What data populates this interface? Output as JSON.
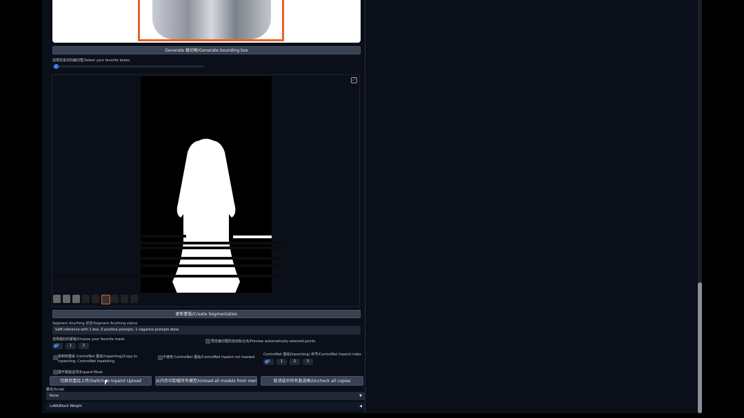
{
  "buttons": {
    "generate_bbox": "Generate 裁切框/Generate bounding box",
    "create_mask": "更新蒙版/Create Segmentation",
    "switch_inpaint": "切换到重绘上传/Switch to Inpaint Upload",
    "unload_models": "从内存中卸载所有模型/Unload all models from memory",
    "uncheck_all": "取消选中所有复选框/Uncheck all copies"
  },
  "labels": {
    "select_box": "选择您喜欢的裁切框/Select your favorite boxes",
    "sam_status": "Segment Anything 状态/Segment Anything status",
    "sam_status_value": "SaM inference with 1 box, 0 positive prompts, 1 negative prompts done",
    "choose_mask": "选择最好的蒙版/Choose your favorite mask:",
    "preview_auto": "预览裁切框的自动标记点/Preview automatically selected points",
    "copy_to_inpaint": "复制到重绘 ControlNet 重绘(Inpainting)/Copy to Inpainting, ControlNet Inpainting",
    "controlnet_inpaint": "不使用 ControlNet 重绘/ControlNet Inpaint not masked",
    "controlnet_index": "ControlNet 重绘(Inpainting) 序号/ControlNet Inpaint index",
    "expand_mask": "展开蒙版选项/Expand Mask",
    "script": "脚本/Script",
    "script_value": "None",
    "lora_weight": "LoRA/Block Weight"
  },
  "radios": {
    "mask_choices": [
      "0",
      "1",
      "2"
    ],
    "index_choices": [
      "0",
      "1",
      "2",
      "3"
    ]
  },
  "colors": {
    "accent": "#e8602c",
    "radio_on": "#3b82f6",
    "bg": "#0b0f19"
  }
}
